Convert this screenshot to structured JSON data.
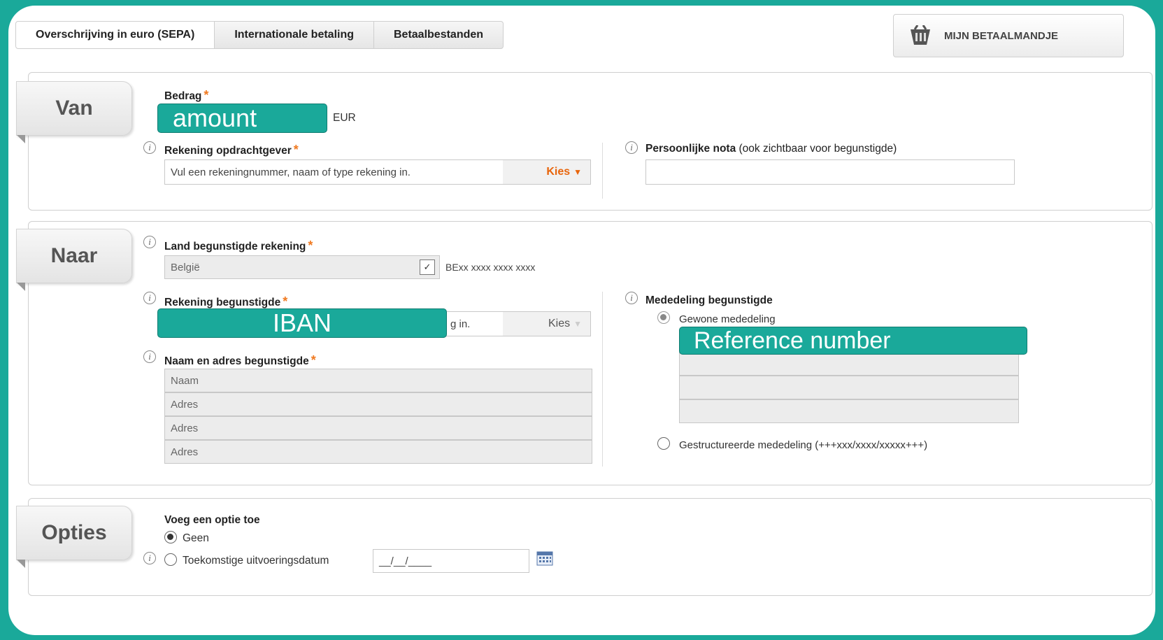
{
  "tabs": [
    "Overschrijving in euro (SEPA)",
    "Internationale betaling",
    "Betaalbestanden"
  ],
  "basket_label": "MIJN BETAALMANDJE",
  "van": {
    "title": "Van",
    "amount_label": "Bedrag",
    "amount_overlay": "amount",
    "currency": "EUR",
    "account_label": "Rekening opdrachtgever",
    "account_placeholder": "Vul een rekeningnummer, naam of type rekening in.",
    "kies": "Kies",
    "note_label": "Persoonlijke nota",
    "note_hint": "(ook zichtbaar voor begunstigde)",
    "note_value": ""
  },
  "naar": {
    "title": "Naar",
    "country_label": "Land begunstigde rekening",
    "country_value": "België",
    "iban_format": "BExx xxxx xxxx xxxx",
    "account_label": "Rekening begunstigde",
    "account_overlay": "IBAN",
    "account_visible_tail": "g in.",
    "kies": "Kies",
    "name_label": "Naam en adres begunstigde",
    "name_fields": [
      "Naam",
      "Adres",
      "Adres",
      "Adres"
    ],
    "message_label": "Mededeling begunstigde",
    "radio_plain": "Gewone mededeling",
    "reference_overlay": "Reference number",
    "radio_structured": "Gestructureerde mededeling (+++xxx/xxxx/xxxxx+++)"
  },
  "opties": {
    "title": "Opties",
    "add_option_label": "Voeg een optie toe",
    "option_none": "Geen",
    "option_future": "Toekomstige uitvoeringsdatum",
    "date_value": "__/__/____"
  },
  "icons": {
    "info": "info-icon",
    "required": "required-asterisk",
    "basket": "basket-icon",
    "calendar": "calendar-icon",
    "dropdown": "chevron-down-icon"
  },
  "colors": {
    "accent": "#1aa99a",
    "required": "#f07a21",
    "kies_active": "#e8650c"
  }
}
